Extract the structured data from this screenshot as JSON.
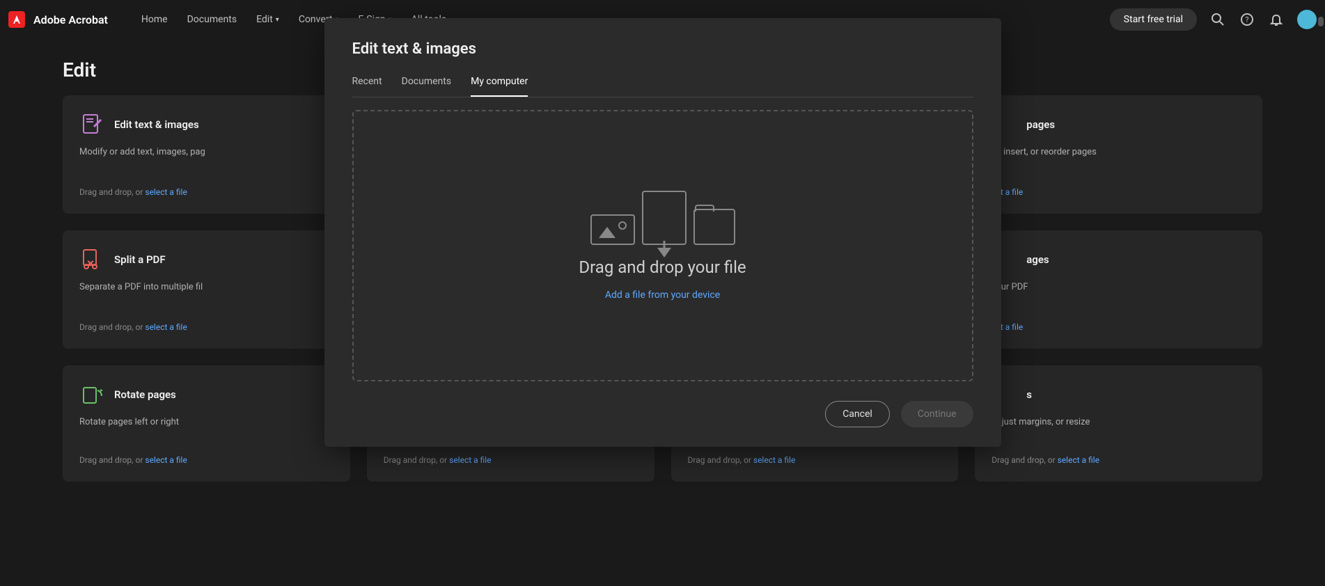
{
  "app": {
    "name": "Adobe Acrobat"
  },
  "nav": {
    "home": "Home",
    "documents": "Documents",
    "edit": "Edit",
    "convert": "Convert",
    "esign": "E-Sign",
    "alltools": "All tools"
  },
  "topRight": {
    "trial": "Start free trial"
  },
  "page": {
    "title": "Edit"
  },
  "cards": [
    {
      "title": "Edit text & images",
      "desc": "Modify or add text, images, pag",
      "footerPrefix": "Drag and drop, or ",
      "footerLink": "select a file"
    },
    {
      "title": "pages",
      "desc": "ct, insert, or reorder pages",
      "footerPrefix": "",
      "footerLink": "ect a file"
    },
    {
      "title": "Split a PDF",
      "desc": "Separate a PDF into multiple fil",
      "footerPrefix": "Drag and drop, or ",
      "footerLink": "select a file"
    },
    {
      "title": "ages",
      "desc": "your PDF",
      "footerPrefix": "",
      "footerLink": "ect a file"
    },
    {
      "title": "Rotate pages",
      "desc": "Rotate pages left or right",
      "footerPrefix": "Drag and drop, or ",
      "footerLink": "select a file"
    },
    {
      "title": "",
      "desc": "",
      "footerPrefix": "Drag and drop, or ",
      "footerLink": "select a file"
    },
    {
      "title": "",
      "desc": "",
      "footerPrefix": "Drag and drop, or ",
      "footerLink": "select a file"
    },
    {
      "title": "s",
      "desc": "adjust margins, or resize",
      "footerPrefix": "Drag and drop, or ",
      "footerLink": "select a file"
    }
  ],
  "modal": {
    "title": "Edit text & images",
    "tabs": {
      "recent": "Recent",
      "documents": "Documents",
      "mycomputer": "My computer"
    },
    "dropzone": {
      "text": "Drag and drop your file",
      "link": "Add a file from your device"
    },
    "cancel": "Cancel",
    "continue": "Continue"
  }
}
